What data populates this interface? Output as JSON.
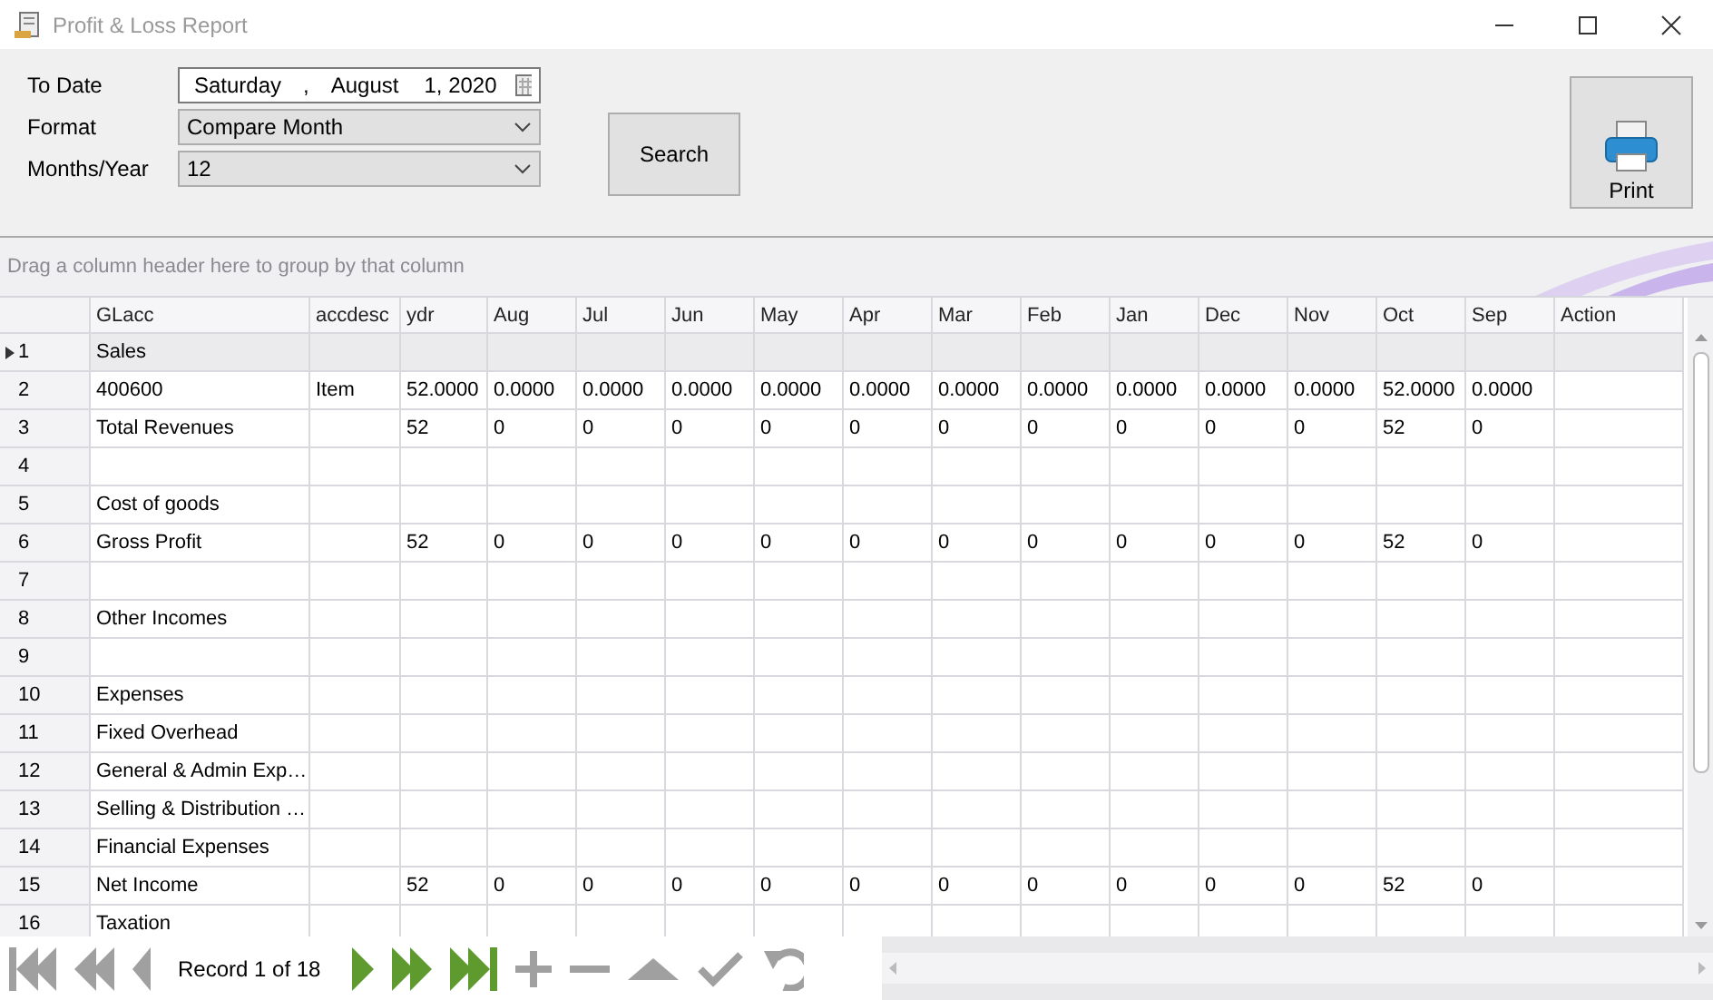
{
  "window": {
    "title": "Profit & Loss Report"
  },
  "filters": [
    {
      "label": "To Date",
      "kind": "date",
      "value_parts": [
        "Saturday",
        ",",
        "August",
        "1, 2020"
      ]
    },
    {
      "label": "Format",
      "kind": "combo",
      "value": "Compare Month"
    },
    {
      "label": "Months/Year",
      "kind": "combo",
      "value": "12"
    }
  ],
  "search_button": "Search",
  "print_button": "Print",
  "group_panel": {
    "placeholder": "Drag a column header here to group by that column"
  },
  "table": {
    "columns": [
      "GLacc",
      "accdesc",
      "ydr",
      "Aug",
      "Jul",
      "Jun",
      "May",
      "Apr",
      "Mar",
      "Feb",
      "Jan",
      "Dec",
      "Nov",
      "Oct",
      "Sep",
      "Action"
    ],
    "rows": [
      {
        "number": "1",
        "selected": true,
        "cells": [
          "Sales",
          null,
          null,
          null,
          null,
          null,
          null,
          null,
          null,
          null,
          null,
          null,
          null,
          null,
          null,
          null
        ]
      },
      {
        "number": "2",
        "selected": false,
        "cells": [
          "400600",
          "Item",
          "52.0000",
          "0.0000",
          "0.0000",
          "0.0000",
          "0.0000",
          "0.0000",
          "0.0000",
          "0.0000",
          "0.0000",
          "0.0000",
          "0.0000",
          "52.0000",
          "0.0000",
          null
        ]
      },
      {
        "number": "3",
        "selected": false,
        "cells": [
          "Total Revenues",
          null,
          "52",
          "0",
          "0",
          "0",
          "0",
          "0",
          "0",
          "0",
          "0",
          "0",
          "0",
          "52",
          "0",
          null
        ]
      },
      {
        "number": "4",
        "selected": false,
        "cells": [
          null,
          null,
          null,
          null,
          null,
          null,
          null,
          null,
          null,
          null,
          null,
          null,
          null,
          null,
          null,
          null
        ]
      },
      {
        "number": "5",
        "selected": false,
        "cells": [
          "Cost of goods",
          null,
          null,
          null,
          null,
          null,
          null,
          null,
          null,
          null,
          null,
          null,
          null,
          null,
          null,
          null
        ]
      },
      {
        "number": "6",
        "selected": false,
        "cells": [
          "Gross Profit",
          null,
          "52",
          "0",
          "0",
          "0",
          "0",
          "0",
          "0",
          "0",
          "0",
          "0",
          "0",
          "52",
          "0",
          null
        ]
      },
      {
        "number": "7",
        "selected": false,
        "cells": [
          null,
          null,
          null,
          null,
          null,
          null,
          null,
          null,
          null,
          null,
          null,
          null,
          null,
          null,
          null,
          null
        ]
      },
      {
        "number": "8",
        "selected": false,
        "cells": [
          "Other Incomes",
          null,
          null,
          null,
          null,
          null,
          null,
          null,
          null,
          null,
          null,
          null,
          null,
          null,
          null,
          null
        ]
      },
      {
        "number": "9",
        "selected": false,
        "cells": [
          null,
          null,
          null,
          null,
          null,
          null,
          null,
          null,
          null,
          null,
          null,
          null,
          null,
          null,
          null,
          null
        ]
      },
      {
        "number": "10",
        "selected": false,
        "cells": [
          "Expenses",
          null,
          null,
          null,
          null,
          null,
          null,
          null,
          null,
          null,
          null,
          null,
          null,
          null,
          null,
          null
        ]
      },
      {
        "number": "11",
        "selected": false,
        "cells": [
          "Fixed Overhead",
          null,
          null,
          null,
          null,
          null,
          null,
          null,
          null,
          null,
          null,
          null,
          null,
          null,
          null,
          null
        ]
      },
      {
        "number": "12",
        "selected": false,
        "cells": [
          "General & Admin Exp…",
          null,
          null,
          null,
          null,
          null,
          null,
          null,
          null,
          null,
          null,
          null,
          null,
          null,
          null,
          null
        ]
      },
      {
        "number": "13",
        "selected": false,
        "cells": [
          "Selling & Distribution …",
          null,
          null,
          null,
          null,
          null,
          null,
          null,
          null,
          null,
          null,
          null,
          null,
          null,
          null,
          null
        ]
      },
      {
        "number": "14",
        "selected": false,
        "cells": [
          "Financial Expenses",
          null,
          null,
          null,
          null,
          null,
          null,
          null,
          null,
          null,
          null,
          null,
          null,
          null,
          null,
          null
        ]
      },
      {
        "number": "15",
        "selected": false,
        "cells": [
          "Net Income",
          null,
          "52",
          "0",
          "0",
          "0",
          "0",
          "0",
          "0",
          "0",
          "0",
          "0",
          "0",
          "52",
          "0",
          null
        ]
      },
      {
        "number": "16",
        "selected": false,
        "cells": [
          "Taxation",
          null,
          null,
          null,
          null,
          null,
          null,
          null,
          null,
          null,
          null,
          null,
          null,
          null,
          null,
          null
        ]
      }
    ]
  },
  "navigator": {
    "record_text": "Record 1 of 18",
    "buttons": [
      {
        "kind": "first",
        "disabled": true
      },
      {
        "kind": "prev_page",
        "disabled": true
      },
      {
        "kind": "prev",
        "disabled": true
      },
      {
        "kind": "record"
      },
      {
        "kind": "next",
        "disabled": false
      },
      {
        "kind": "next_page",
        "disabled": false
      },
      {
        "kind": "last",
        "disabled": false
      },
      {
        "kind": "append",
        "disabled": true
      },
      {
        "kind": "remove",
        "disabled": true
      },
      {
        "kind": "edit",
        "disabled": true
      },
      {
        "kind": "end_edit",
        "disabled": true
      },
      {
        "kind": "cancel_edit",
        "disabled": true
      }
    ]
  }
}
